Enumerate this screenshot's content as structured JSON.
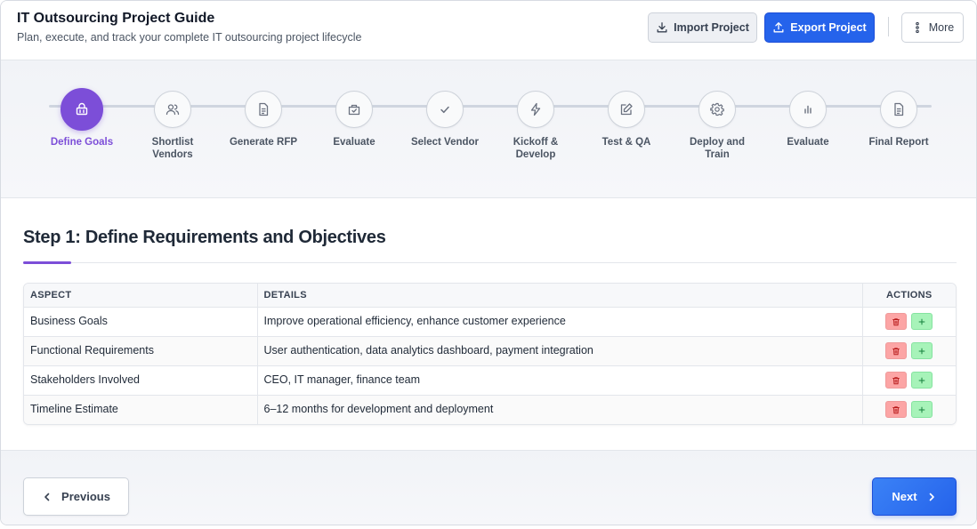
{
  "header": {
    "title": "IT Outsourcing Project Guide",
    "subtitle": "Plan, execute, and track your complete IT outsourcing project lifecycle",
    "import_label": "Import Project",
    "export_label": "Export Project",
    "more_label": "More"
  },
  "steps": [
    {
      "label": "Define Goals",
      "icon": "basket-icon",
      "active": true
    },
    {
      "label": "Shortlist Vendors",
      "icon": "users-icon",
      "active": false
    },
    {
      "label": "Generate RFP",
      "icon": "document-icon",
      "active": false
    },
    {
      "label": "Evaluate",
      "icon": "clipboard-check-icon",
      "active": false
    },
    {
      "label": "Select Vendor",
      "icon": "check-icon",
      "active": false
    },
    {
      "label": "Kickoff & Develop",
      "icon": "lightning-icon",
      "active": false
    },
    {
      "label": "Test & QA",
      "icon": "edit-icon",
      "active": false
    },
    {
      "label": "Deploy and Train",
      "icon": "gear-icon",
      "active": false
    },
    {
      "label": "Evaluate",
      "icon": "bar-chart-icon",
      "active": false
    },
    {
      "label": "Final Report",
      "icon": "report-icon",
      "active": false
    }
  ],
  "main": {
    "step_title": "Step 1: Define Requirements and Objectives",
    "table": {
      "headers": [
        "ASPECT",
        "DETAILS",
        "ACTIONS"
      ],
      "rows": [
        {
          "aspect": "Business Goals",
          "details": "Improve operational efficiency, enhance customer experience"
        },
        {
          "aspect": "Functional Requirements",
          "details": "User authentication, data analytics dashboard, payment integration"
        },
        {
          "aspect": "Stakeholders Involved",
          "details": "CEO, IT manager, finance team"
        },
        {
          "aspect": "Timeline Estimate",
          "details": "6–12 months for development and deployment"
        }
      ]
    }
  },
  "footer": {
    "previous_label": "Previous",
    "next_label": "Next"
  },
  "colors": {
    "accent_purple": "#7c4ed8",
    "primary_blue": "#2563eb",
    "delete_red": "#fca5a5",
    "add_green": "#a7f3b9"
  }
}
